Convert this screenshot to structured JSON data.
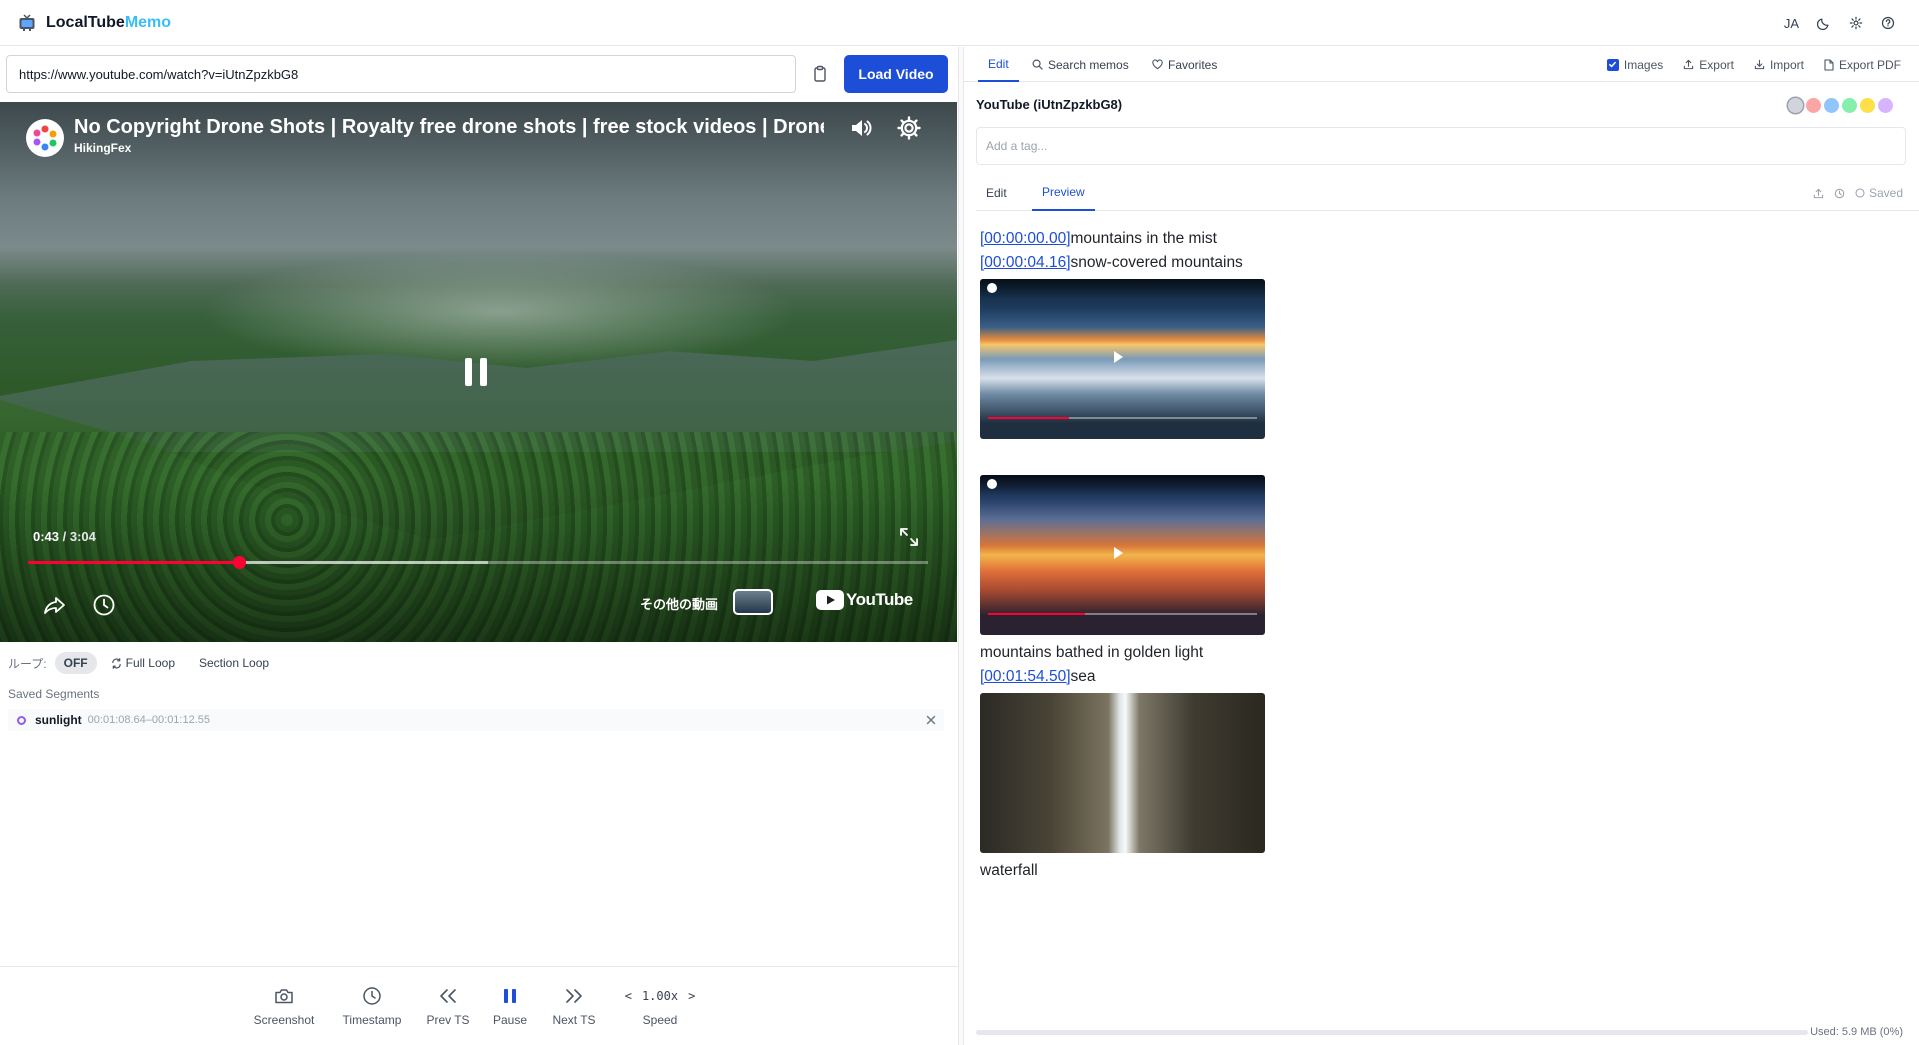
{
  "app": {
    "name_main": "LocalTube",
    "name_accent": "Memo",
    "language": "JA"
  },
  "url_bar": {
    "value": "https://www.youtube.com/watch?v=iUtnZpzkbG8",
    "load_label": "Load Video"
  },
  "player": {
    "title": "No Copyright Drone Shots | Royalty free drone shots | free stock videos | Drone footage",
    "channel": "HikingFex",
    "current_time": "0:43",
    "separator": " / ",
    "duration": "3:04",
    "played_fraction": 0.234,
    "buffered_fraction": 0.511,
    "more_videos_label": "その他の動画",
    "youtube_label": "YouTube"
  },
  "loop": {
    "label": "ループ:",
    "state": "OFF",
    "full_loop": "Full Loop",
    "section_loop": "Section Loop"
  },
  "segments": {
    "title": "Saved Segments",
    "items": [
      {
        "name": "sunlight",
        "range": "00:01:08.64–00:01:12.55"
      }
    ]
  },
  "controls": {
    "screenshot": "Screenshot",
    "timestamp": "Timestamp",
    "prev_ts": "Prev TS",
    "pause": "Pause",
    "next_ts": "Next TS",
    "speed_value": "1.00x",
    "speed_label": "Speed",
    "speed_down": "<",
    "speed_up": ">"
  },
  "right_tabs": {
    "edit": "Edit",
    "search": "Search memos",
    "favorites": "Favorites",
    "images": "Images",
    "images_checked": true,
    "export": "Export",
    "import": "Import",
    "export_pdf": "Export PDF"
  },
  "memo": {
    "title": "YouTube (iUtnZpzkbG8)",
    "tag_placeholder": "Add a tag...",
    "colors": [
      "#d1d5db",
      "#fca5a5",
      "#93c5fd",
      "#86efac",
      "#fde047",
      "#d8b4fe"
    ],
    "subtab_edit": "Edit",
    "subtab_preview": "Preview",
    "save_state": "Saved",
    "lines": [
      {
        "ts": "[00:00:00.00]",
        "text": "mountains in the mist"
      },
      {
        "ts": "[00:00:04.16]",
        "text": "snow-covered mountains"
      },
      {
        "ts": "",
        "text": "mountains bathed in golden light"
      },
      {
        "ts": "[00:01:54.50]",
        "text": "sea"
      },
      {
        "ts": "",
        "text": "waterfall"
      }
    ]
  },
  "storage": {
    "used": "Used: 5.9 MB (0%)"
  }
}
